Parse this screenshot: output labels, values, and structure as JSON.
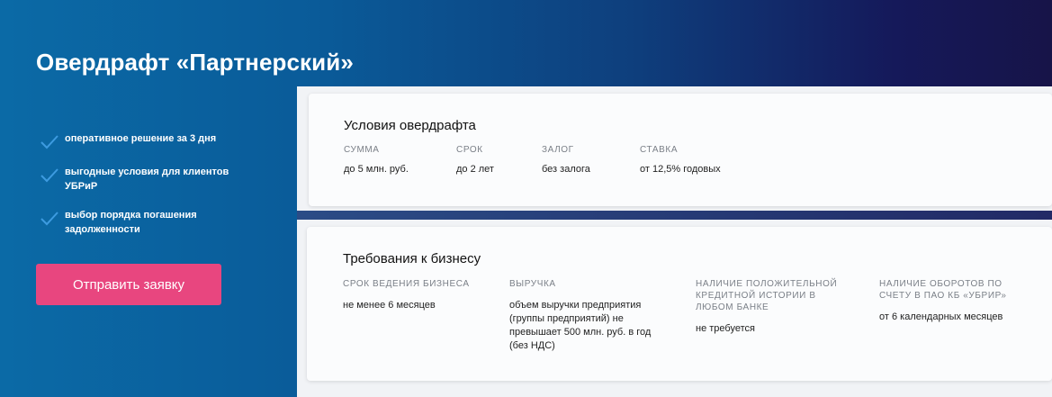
{
  "hero": {
    "title": "Овердрафт «Партнерский»"
  },
  "benefits": [
    {
      "icon": "check-icon",
      "text": "оперативное решение за 3 дня"
    },
    {
      "icon": "check-icon",
      "text": "выгодные условия для клиентов УБРиР"
    },
    {
      "icon": "check-icon",
      "text": "выбор порядка погашения задолженности"
    }
  ],
  "apply_button": {
    "label": "Отправить заявку",
    "color": "#e8467f"
  },
  "conditions": {
    "title": "Условия овердрафта",
    "columns": [
      {
        "label": "СУММА",
        "value": "до 5 млн. руб."
      },
      {
        "label": "СРОК",
        "value": "до 2 лет"
      },
      {
        "label": "ЗАЛОГ",
        "value": "без залога"
      },
      {
        "label": "СТАВКА",
        "value": "от 12,5% годовых"
      }
    ]
  },
  "requirements": {
    "title": "Требования к бизнесу",
    "columns": [
      {
        "label": "СРОК ВЕДЕНИЯ БИЗНЕСА",
        "value": "не менее 6 месяцев"
      },
      {
        "label": "ВЫРУЧКА",
        "value": "объем выручки предприятия (группы предприятий) не превышает 500 млн. руб. в год (без НДС)"
      },
      {
        "label": "НАЛИЧИЕ ПОЛОЖИТЕЛЬНОЙ КРЕДИТНОЙ ИСТОРИИ В ЛЮБОМ БАНКЕ",
        "value": "не требуется"
      },
      {
        "label": "НАЛИЧИЕ ОБОРОТОВ ПО СЧЕТУ В ПАО КБ «УБРИР»",
        "value": "от 6 календарных месяцев"
      }
    ]
  }
}
